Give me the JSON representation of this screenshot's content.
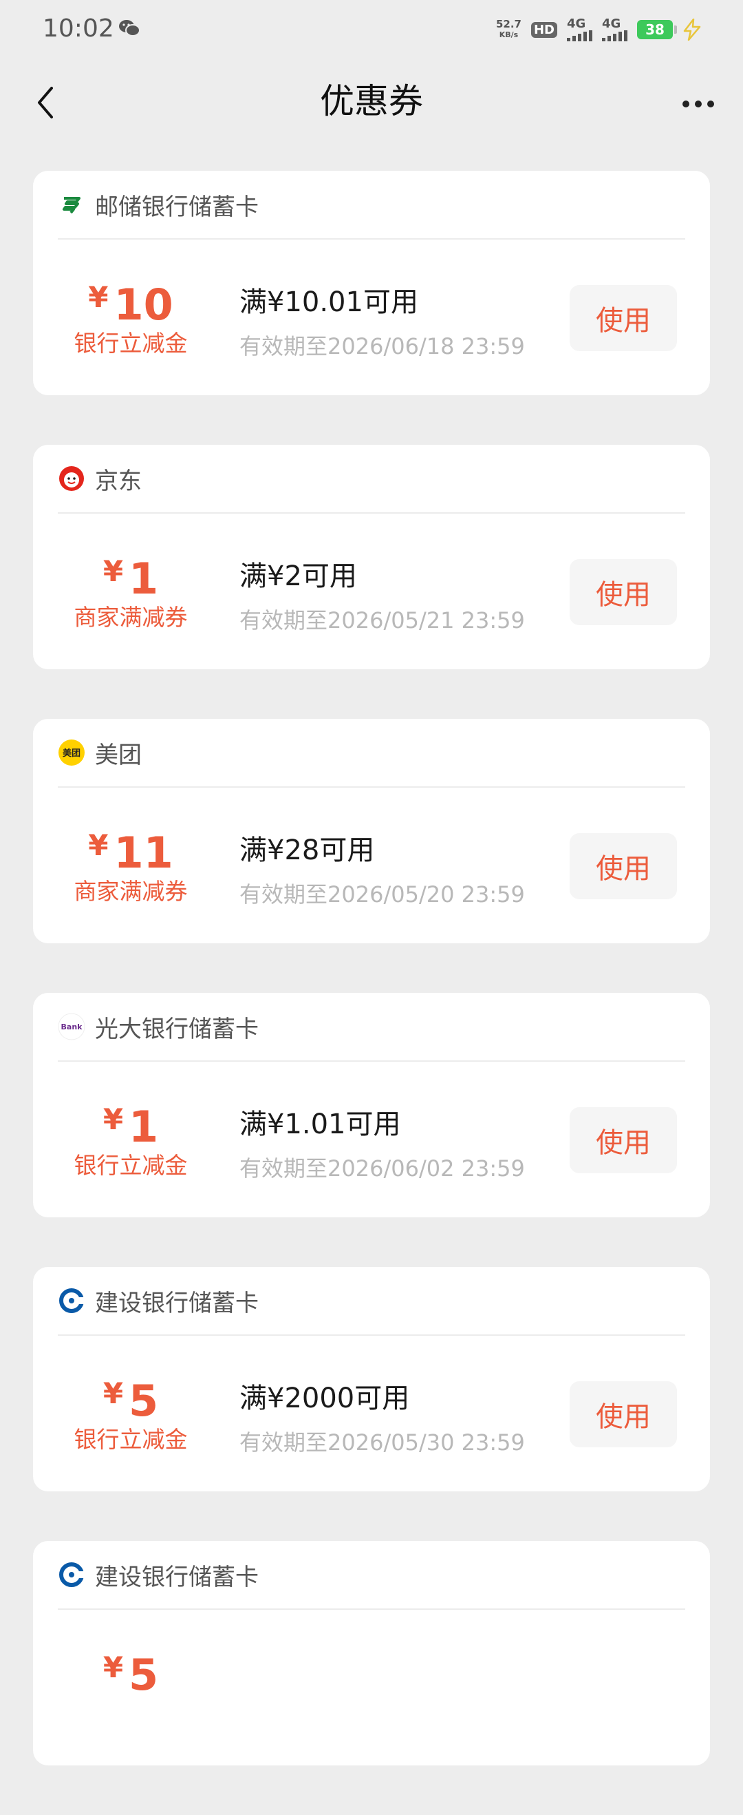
{
  "status_bar": {
    "time": "10:02",
    "net_speed_value": "52.7",
    "net_speed_unit": "KB/s",
    "hd": "HD",
    "sim1": "4G",
    "sim2": "4G",
    "battery": "38"
  },
  "header": {
    "title": "优惠券"
  },
  "coupons": [
    {
      "merchant": "邮储银行储蓄卡",
      "logo": "psbc-logo",
      "symbol": "¥",
      "amount": "10",
      "type": "银行立减金",
      "condition": "满¥10.01可用",
      "validity": "有效期至2026/06/18 23:59",
      "action": "使用"
    },
    {
      "merchant": "京东",
      "logo": "jd-logo",
      "symbol": "¥",
      "amount": "1",
      "type": "商家满减券",
      "condition": "满¥2可用",
      "validity": "有效期至2026/05/21 23:59",
      "action": "使用"
    },
    {
      "merchant": "美团",
      "logo": "meituan-logo",
      "logo_text": "美团",
      "symbol": "¥",
      "amount": "11",
      "type": "商家满减券",
      "condition": "满¥28可用",
      "validity": "有效期至2026/05/20 23:59",
      "action": "使用"
    },
    {
      "merchant": "光大银行储蓄卡",
      "logo": "cebbank-logo",
      "logo_text": "Bank",
      "symbol": "¥",
      "amount": "1",
      "type": "银行立减金",
      "condition": "满¥1.01可用",
      "validity": "有效期至2026/06/02 23:59",
      "action": "使用"
    },
    {
      "merchant": "建设银行储蓄卡",
      "logo": "ccb-logo",
      "symbol": "¥",
      "amount": "5",
      "type": "银行立减金",
      "condition": "满¥2000可用",
      "validity": "有效期至2026/05/30 23:59",
      "action": "使用"
    },
    {
      "merchant": "建设银行储蓄卡",
      "logo": "ccb-logo",
      "symbol": "¥",
      "amount": "5",
      "type": "",
      "condition": "",
      "validity": "",
      "action": ""
    }
  ],
  "colors": {
    "accent": "#ec5c3c",
    "background": "#ededed",
    "card": "#ffffff",
    "muted_text": "#b8b8b8"
  }
}
